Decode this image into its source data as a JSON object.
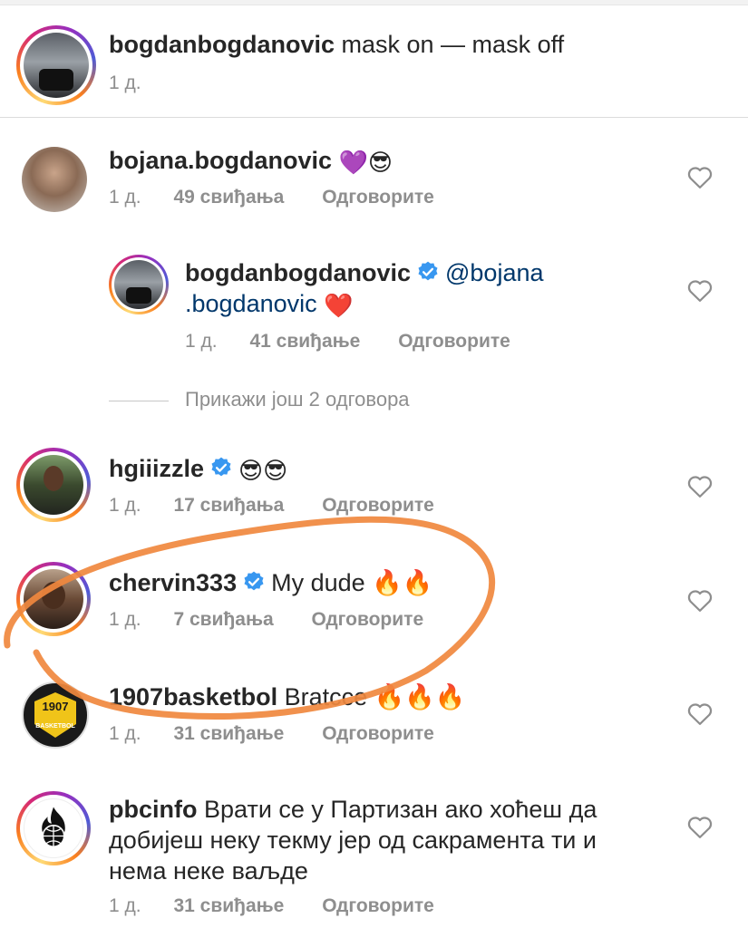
{
  "caption": {
    "username": "bogdanbogdanovic",
    "text": "mask on — mask off",
    "time": "1 д."
  },
  "comments": [
    {
      "username": "bojana.bogdanovic",
      "verified": false,
      "text": "💜😎",
      "time": "1 д.",
      "likes": "49 свиђања",
      "reply": "Одговорите"
    },
    {
      "username": "bogdanbogdanovic",
      "verified": true,
      "mention_line1": "@bojana",
      "mention_line2": ".bogdanovic",
      "text_after": "❤️",
      "time": "1 д.",
      "likes": "41 свиђање",
      "reply": "Одговорите"
    },
    {
      "username": "hgiiizzle",
      "verified": true,
      "text": "😎😎",
      "time": "1 д.",
      "likes": "17 свиђања",
      "reply": "Одговорите"
    },
    {
      "username": "chervin333",
      "verified": true,
      "text": "My dude 🔥🔥",
      "time": "1 д.",
      "likes": "7 свиђања",
      "reply": "Одговорите"
    },
    {
      "username": "1907basketbol",
      "verified": false,
      "text": "Bratcce 🔥🔥🔥",
      "time": "1 д.",
      "likes": "31 свиђање",
      "reply": "Одговорите"
    },
    {
      "username": "pbcinfo",
      "verified": false,
      "text_line1": "Врати се у Партизан ако хоћеш да",
      "text_line2": "добијеш неку текму јер од сакрамента ти и",
      "text_line3": "нема неке ваљде",
      "time": "1 д.",
      "likes": "31 свиђање",
      "reply": "Одговорите"
    }
  ],
  "view_more_replies": "Прикажи још 2 одговора",
  "avatar_1907_text": "1907",
  "avatar_1907_sub": "BASKETBOL",
  "colors": {
    "text": "#262626",
    "meta": "#8e8e8e",
    "mention": "#00376b",
    "verified": "#3897f0",
    "annotation": "#f0883e"
  },
  "icons": [
    "heart-outline-icon",
    "verified-badge-icon"
  ]
}
